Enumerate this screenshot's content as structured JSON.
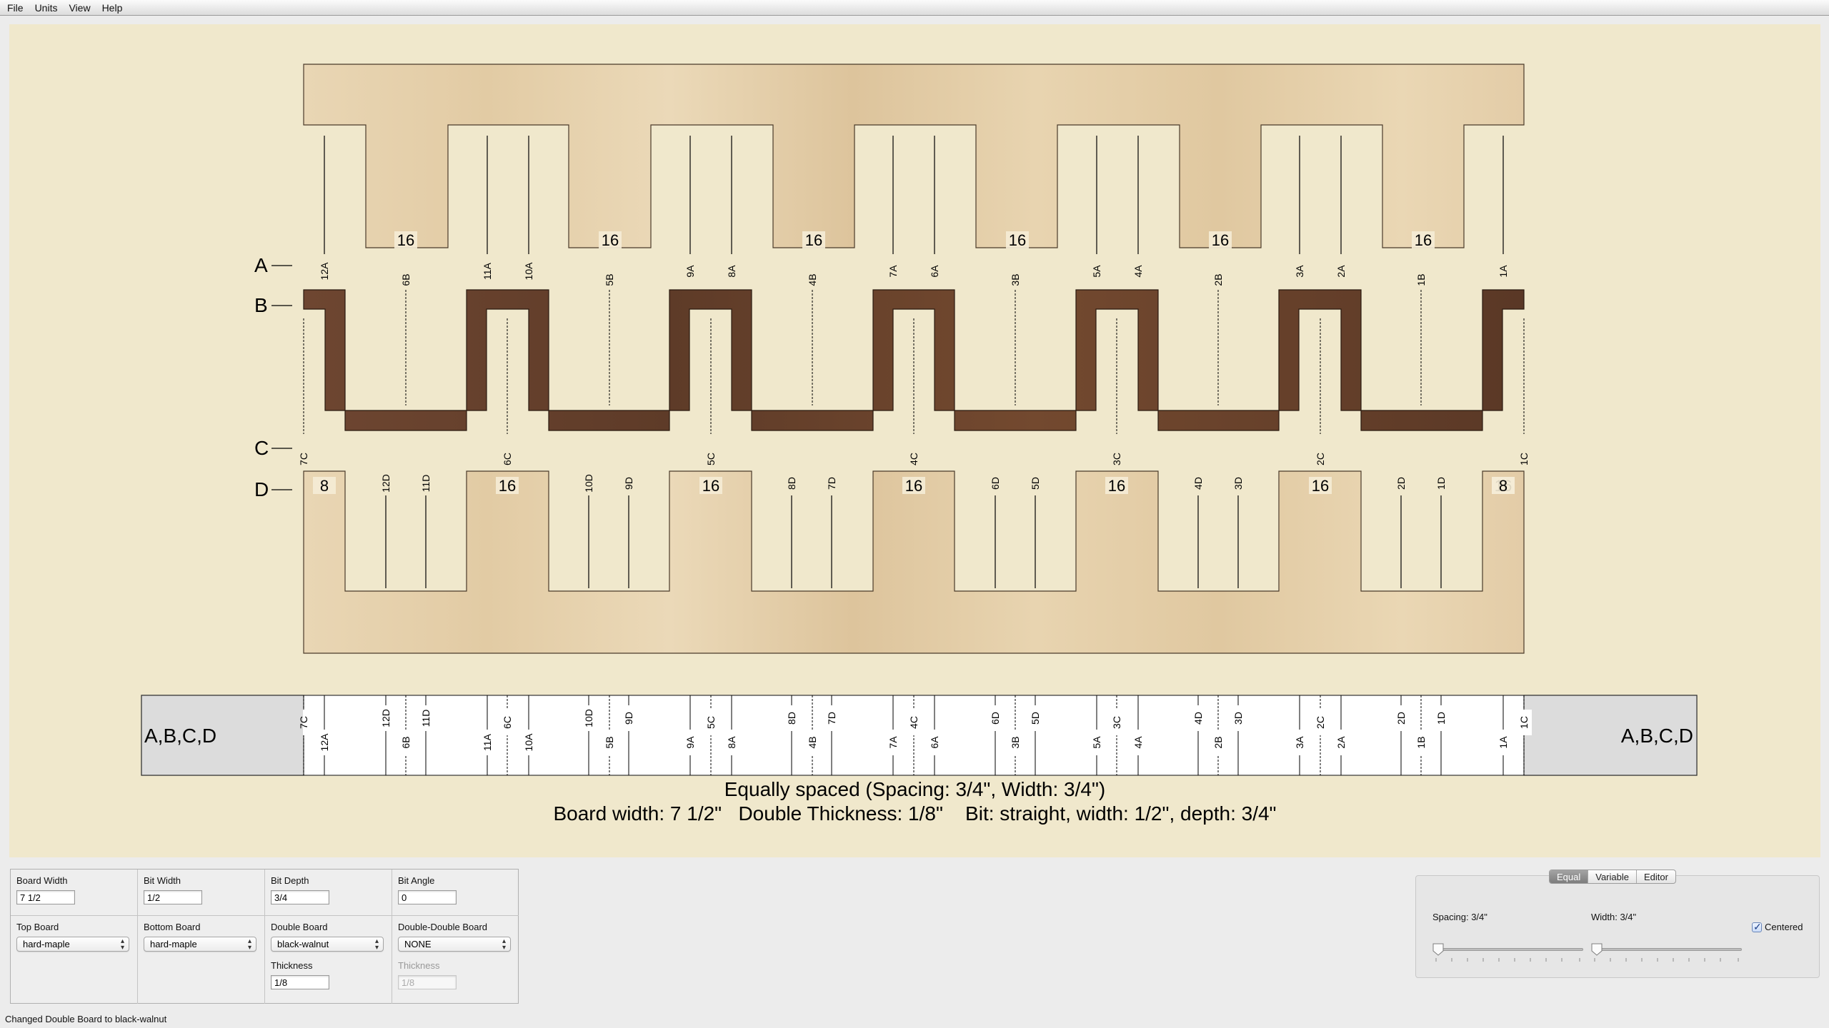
{
  "menu": [
    "File",
    "Units",
    "View",
    "Help"
  ],
  "joint": {
    "row_labels": [
      "A",
      "B",
      "C",
      "D"
    ],
    "board_a_counts": [
      "16",
      "16",
      "16",
      "16",
      "16",
      "16"
    ],
    "board_d_counts": [
      "8",
      "16",
      "16",
      "16",
      "16",
      "16",
      "16",
      "8"
    ],
    "board_a_cuts": [
      "12A",
      "11A",
      "10A",
      "9A",
      "8A",
      "7A",
      "6A",
      "5A",
      "4A",
      "3A",
      "2A",
      "1A"
    ],
    "board_b_cuts": [
      "6B",
      "5B",
      "4B",
      "3B",
      "2B",
      "1B"
    ],
    "board_c_cuts": [
      "7C",
      "6C",
      "5C",
      "4C",
      "3C",
      "2C",
      "1C"
    ],
    "board_d_cuts": [
      "12D",
      "11D",
      "10D",
      "9D",
      "8D",
      "7D",
      "6D",
      "5D",
      "4D",
      "3D",
      "2D",
      "1D"
    ]
  },
  "template": {
    "end_label_left": "A,B,C,D",
    "end_label_right": "A,B,C,D",
    "cuts": [
      "7C",
      "12A",
      "12D",
      "6B",
      "11D",
      "11A",
      "6C",
      "10A",
      "10D",
      "5B",
      "9D",
      "9A",
      "5C",
      "8A",
      "8D",
      "4B",
      "7D",
      "7A",
      "4C",
      "6A",
      "6D",
      "3B",
      "5D",
      "5A",
      "3C",
      "4A",
      "4D",
      "2B",
      "3D",
      "3A",
      "2C",
      "2A",
      "2D",
      "1B",
      "1D",
      "1A",
      "1C"
    ]
  },
  "caption_line1": "Equally spaced (Spacing: 3/4\", Width: 3/4\")",
  "caption_line2": "Board width: 7 1/2\"   Double Thickness: 1/8\"    Bit: straight, width: 1/2\", depth: 3/4\"",
  "params": {
    "board_width": {
      "label": "Board Width",
      "value": "7 1/2"
    },
    "bit_width": {
      "label": "Bit Width",
      "value": "1/2"
    },
    "bit_depth": {
      "label": "Bit Depth",
      "value": "3/4"
    },
    "bit_angle": {
      "label": "Bit Angle",
      "value": "0"
    },
    "top_board": {
      "label": "Top Board",
      "value": "hard-maple"
    },
    "bottom_board": {
      "label": "Bottom Board",
      "value": "hard-maple"
    },
    "double_board": {
      "label": "Double Board",
      "value": "black-walnut",
      "thickness_label": "Thickness",
      "thickness": "1/8"
    },
    "double_double_board": {
      "label": "Double-Double Board",
      "value": "NONE",
      "thickness_label": "Thickness",
      "thickness": "1/8"
    }
  },
  "spacing_panel": {
    "tabs": [
      "Equal",
      "Variable",
      "Editor"
    ],
    "active_tab": "Equal",
    "spacing_label": "Spacing: 3/4\"",
    "width_label": "Width: 3/4\"",
    "spacing_value": 0,
    "width_value": 0,
    "centered_label": "Centered",
    "centered": true
  },
  "status": "Changed Double Board to black-walnut",
  "colors": {
    "canvas": "#f0e8cc",
    "maple": "#e7d2ae",
    "walnut": "#6b4430",
    "template_gray": "#dcdcdc"
  }
}
